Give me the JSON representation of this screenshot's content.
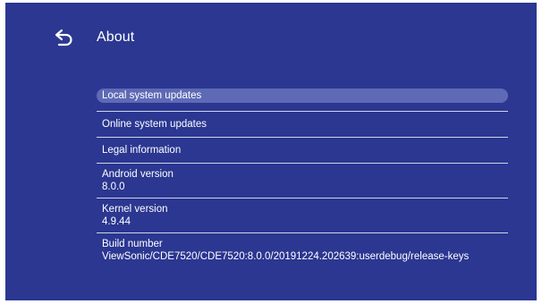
{
  "header": {
    "title": "About",
    "back_icon": "back-arrow-icon"
  },
  "colors": {
    "background": "#2b3791",
    "highlight": "#5e6ab5",
    "divider": "#cfd3ea",
    "text": "#ffffff"
  },
  "menu": {
    "items": [
      {
        "label": "Local system updates",
        "selected": true
      },
      {
        "label": "Online system updates"
      },
      {
        "label": "Legal information"
      },
      {
        "label": "Android version",
        "value": "8.0.0"
      },
      {
        "label": "Kernel version",
        "value": "4.9.44"
      },
      {
        "label": "Build number",
        "value": "ViewSonic/CDE7520/CDE7520:8.0.0/20191224.202639:userdebug/release-keys"
      }
    ]
  }
}
